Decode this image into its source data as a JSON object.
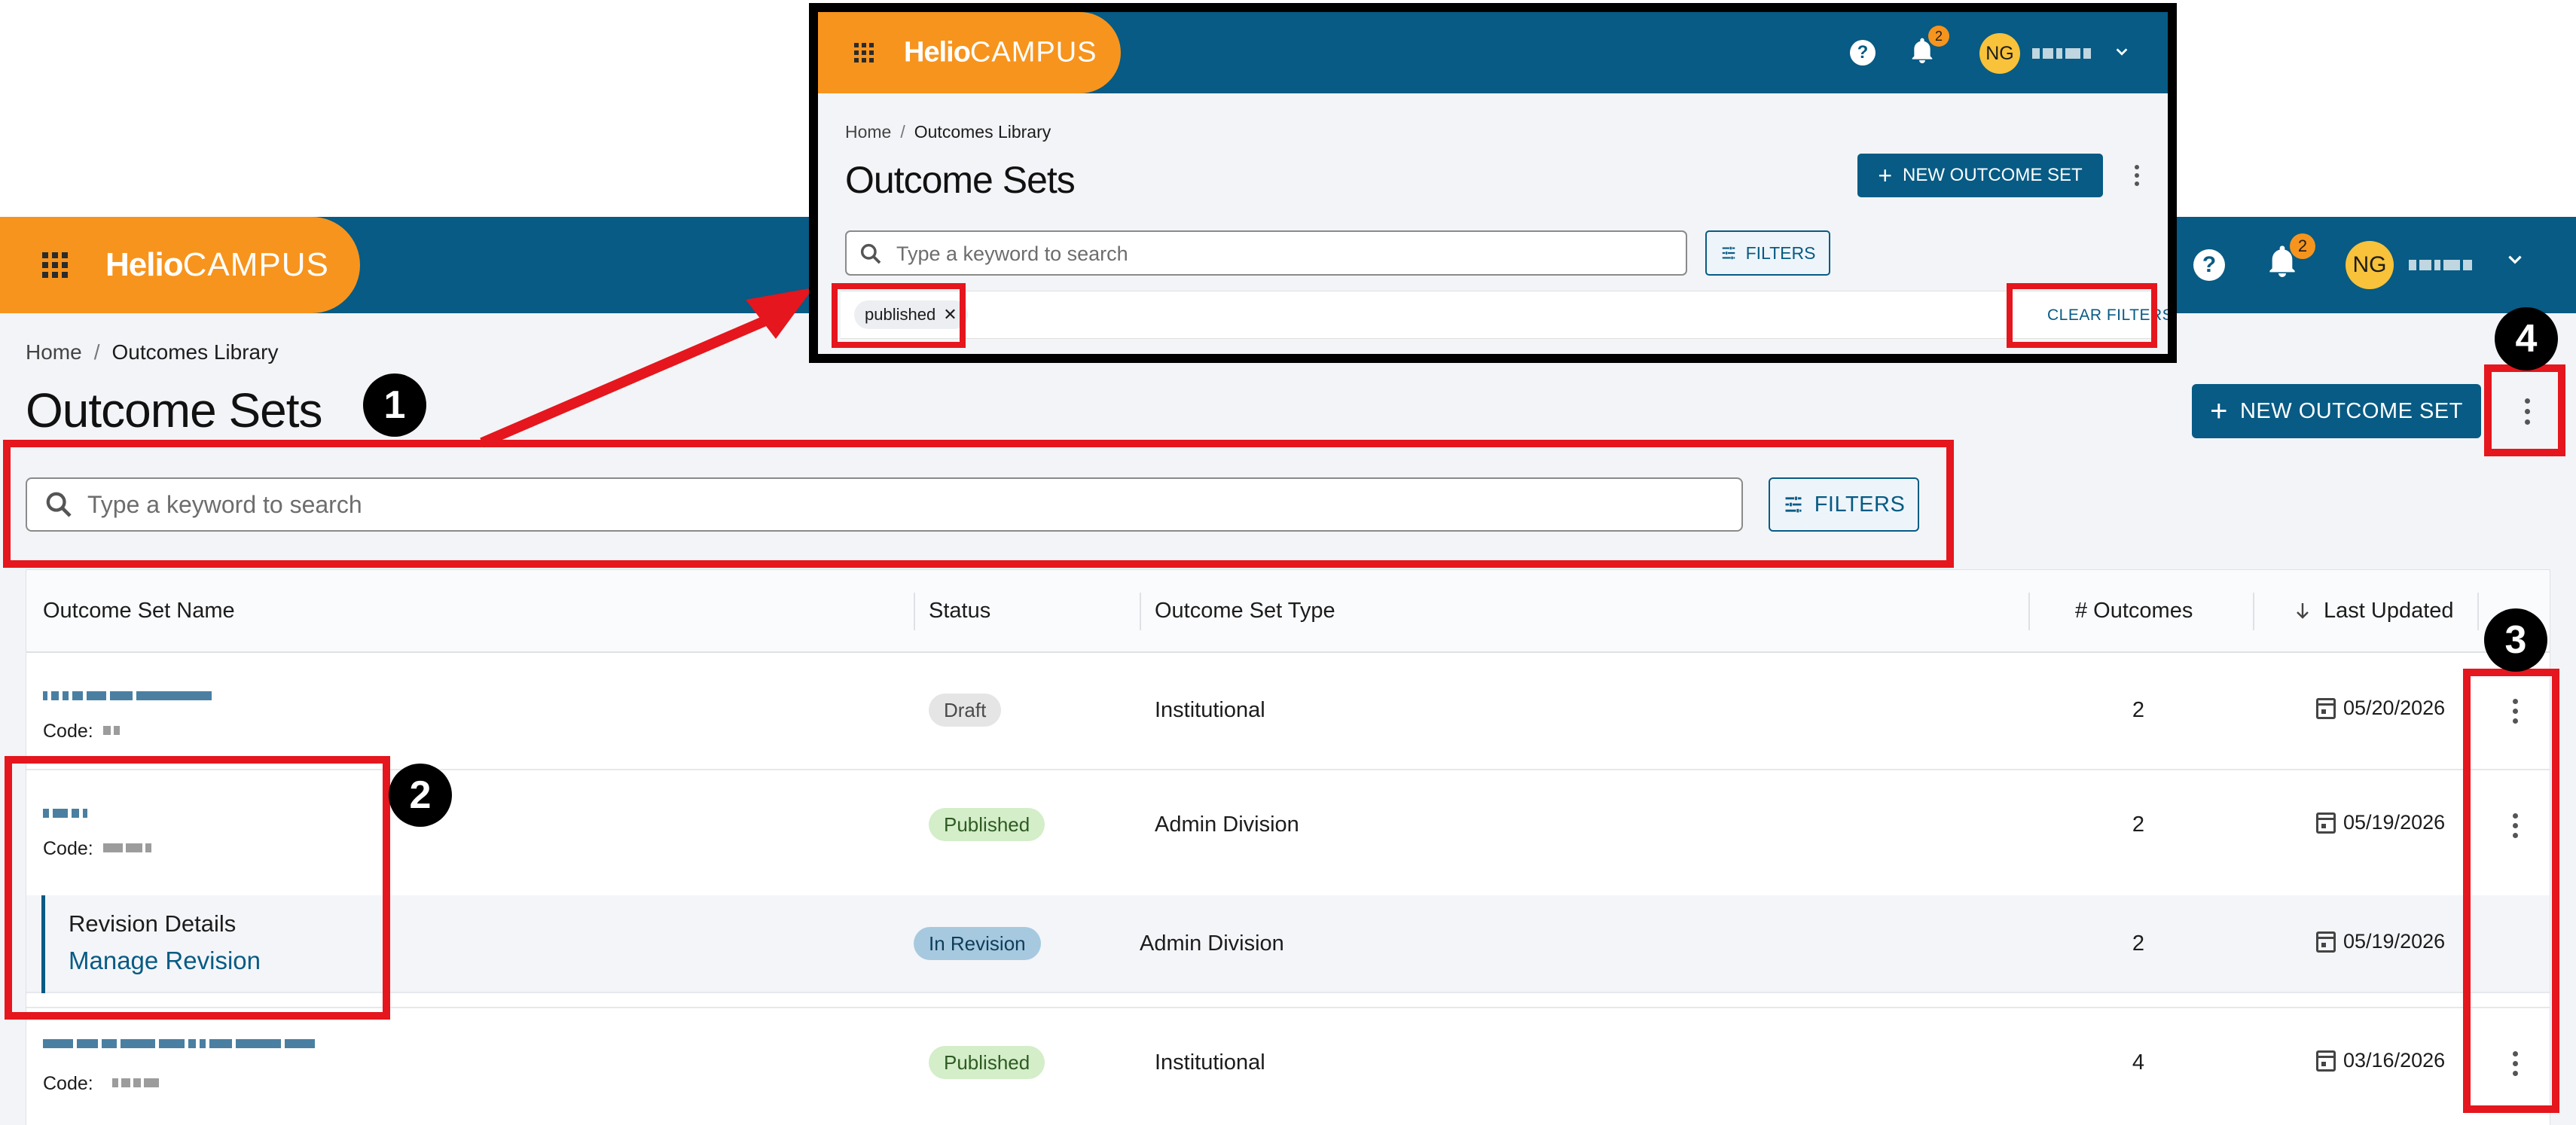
{
  "app": {
    "brand_bold": "Helio",
    "brand_light": "CAMPUS",
    "notifications_count": "2",
    "user_initials": "NG",
    "accent_color": "#075b84",
    "brand_color": "#f7941d"
  },
  "breadcrumb": {
    "home": "Home",
    "separator": "/",
    "current": "Outcomes Library"
  },
  "page": {
    "title": "Outcome Sets",
    "new_button": "NEW OUTCOME SET",
    "search_placeholder": "Type a keyword to search",
    "filters_button": "FILTERS"
  },
  "table": {
    "columns": [
      "Outcome Set Name",
      "Status",
      "Outcome Set Type",
      "# Outcomes",
      "Last Updated"
    ],
    "sort_indicator": "descending",
    "rows": [
      {
        "code_label": "Code:",
        "status": "Draft",
        "type": "Institutional",
        "outcomes": "2",
        "updated": "05/20/2026"
      },
      {
        "code_label": "Code:",
        "status": "Published",
        "type": "Admin Division",
        "outcomes": "2",
        "updated": "05/19/2026"
      },
      {
        "revision_title": "Revision Details",
        "revision_link": "Manage Revision",
        "status": "In Revision",
        "type": "Admin Division",
        "outcomes": "2",
        "updated": "05/19/2026"
      },
      {
        "code_label": "Code:",
        "status": "Published",
        "type": "Institutional",
        "outcomes": "4",
        "updated": "03/16/2026"
      }
    ]
  },
  "inset": {
    "active_filter": "published",
    "clear_filters": "CLEAR FILTERS"
  },
  "annotations": {
    "m1": "1",
    "m2": "2",
    "m3": "3",
    "m4": "4"
  }
}
